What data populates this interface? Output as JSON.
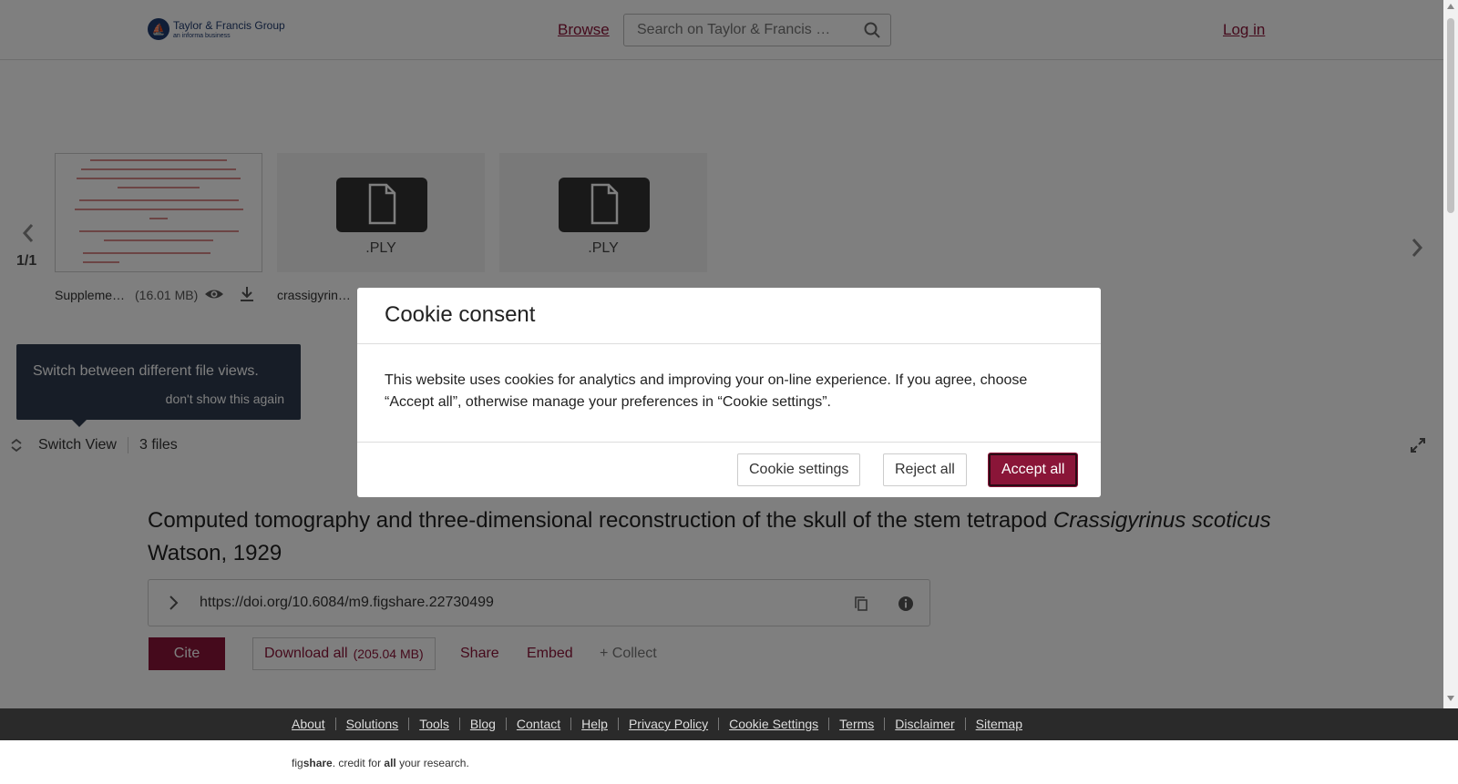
{
  "header": {
    "logo_name": "Taylor & Francis Group",
    "logo_sub": "an informa business",
    "browse": "Browse",
    "search_placeholder": "Search on Taylor & Francis …",
    "login": "Log in"
  },
  "viewer": {
    "page_count": "1/1",
    "files": [
      {
        "label": "Suppleme…",
        "size": "(16.01 MB)"
      },
      {
        "label": "crassigyrin…",
        "ext": ".PLY"
      },
      {
        "ext": ".PLY"
      }
    ],
    "tooltip": {
      "text": "Switch between different file views.",
      "dismiss": "don't show this again"
    },
    "switch_view": "Switch View",
    "files_count": "3 files"
  },
  "article": {
    "title_plain": "Computed tomography and three-dimensional reconstruction of the skull of the stem tetrapod ",
    "title_italic": "Crassigyrinus scoticus",
    "title_tail": " Watson, 1929",
    "doi": "https://doi.org/10.6084/m9.figshare.22730499",
    "cite": "Cite",
    "download_all": "Download all",
    "download_size": "(205.04 MB)",
    "share": "Share",
    "embed": "Embed",
    "collect": "+ Collect"
  },
  "footer": {
    "links": [
      "About",
      "Solutions",
      "Tools",
      "Blog",
      "Contact",
      "Help",
      "Privacy Policy",
      "Cookie Settings",
      "Terms",
      "Disclaimer",
      "Sitemap"
    ],
    "tagline_fig": "fig",
    "tagline_share": "share",
    "tagline_mid": ". credit for ",
    "tagline_all": "all",
    "tagline_end": " your research."
  },
  "modal": {
    "title": "Cookie consent",
    "body": "This website uses cookies for analytics and improving your on-line experience. If you agree, choose “Accept all”, otherwise manage your preferences in “Cookie settings”.",
    "settings": "Cookie settings",
    "reject": "Reject all",
    "accept": "Accept all"
  },
  "colors": {
    "brand": "#8a1538",
    "tooltip_bg": "#2e3b4e",
    "footer_bg": "#2a2a2a"
  }
}
